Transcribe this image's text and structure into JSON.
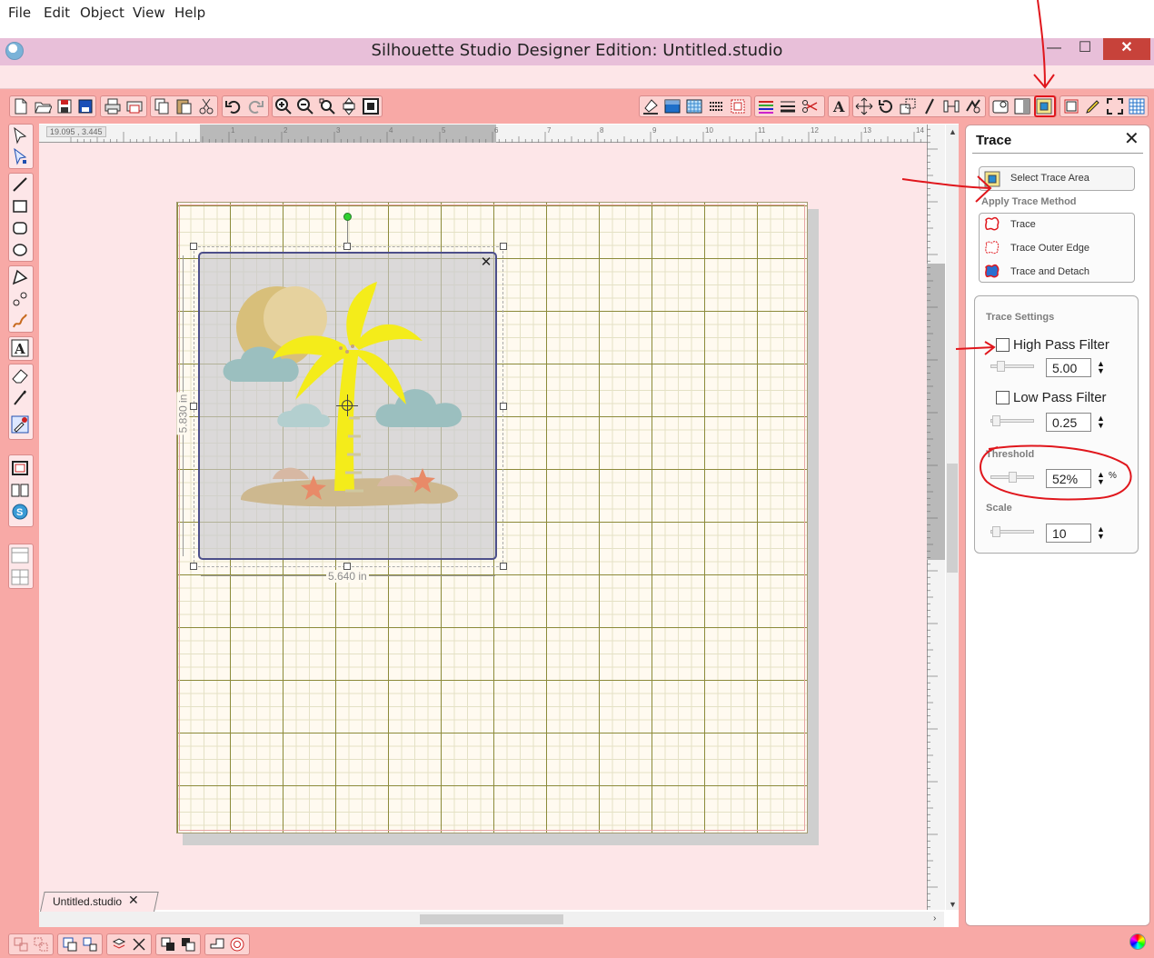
{
  "window": {
    "title": "Silhouette Studio Designer Edition: Untitled.studio",
    "minimize": "—",
    "maximize": "☐",
    "close": "✕"
  },
  "menu": [
    "File",
    "Edit",
    "Object",
    "View",
    "Help"
  ],
  "ruler": {
    "coordinates": "19.095 , 3.445"
  },
  "selection": {
    "width_label": "5.640 in",
    "height_label": "5.830 in"
  },
  "tabs": [
    {
      "label": "Untitled.studio",
      "close": "✕"
    }
  ],
  "trace_panel": {
    "title": "Trace",
    "close": "✕",
    "select_trace_area": "Select Trace Area",
    "apply_trace_method": "Apply Trace Method",
    "methods": [
      "Trace",
      "Trace Outer Edge",
      "Trace and Detach"
    ],
    "settings_title": "Trace Settings",
    "high_pass_filter": {
      "label": "High Pass Filter",
      "checked": false,
      "value": "5.00"
    },
    "low_pass_filter": {
      "label": "Low Pass Filter",
      "checked": false,
      "value": "0.25"
    },
    "threshold": {
      "label": "Threshold",
      "value": "52%",
      "unit": "%"
    },
    "scale": {
      "label": "Scale",
      "value": "10"
    }
  },
  "ruler_numbers": [
    "1",
    "2",
    "3",
    "4",
    "5",
    "6",
    "7",
    "8",
    "9",
    "10",
    "11",
    "12",
    "13",
    "14"
  ],
  "colors": {
    "frame": "#f8a9a6",
    "workspace": "#fde6e8",
    "titlebar": "#e8bfd9",
    "annotation_red": "#e0161c"
  }
}
